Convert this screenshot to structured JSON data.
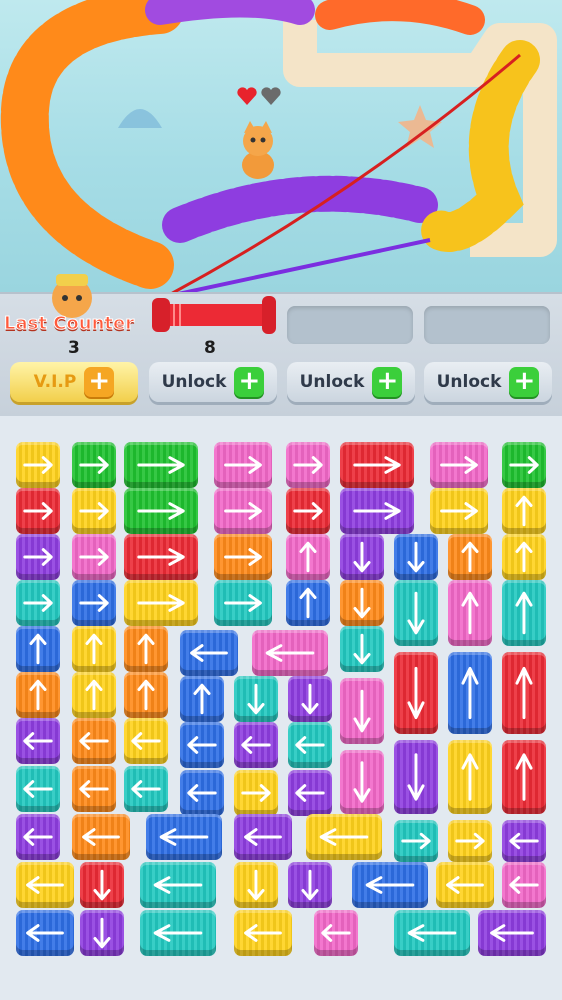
{
  "hud": {
    "last_counter_label": "Last Counter",
    "last_counter_value": "3",
    "spool_count": "8",
    "vip_label": "V.I.P",
    "unlock_label": "Unlock"
  },
  "hearts": [
    "full",
    "empty"
  ],
  "colors": {
    "green": "#1fc230",
    "yellow": "#ffd21c",
    "pink": "#f268c8",
    "red": "#ec2a35",
    "purple": "#8e3de0",
    "blue": "#2e6ee6",
    "teal": "#22c9c0",
    "orange": "#ff8a1a"
  },
  "tiles": [
    {
      "c": "yellow",
      "d": "right"
    },
    {
      "c": "green",
      "d": "right"
    },
    {
      "c": "green",
      "d": "right"
    },
    {
      "c": "pink",
      "d": "right"
    },
    {
      "c": "pink",
      "d": "right"
    },
    {
      "c": "red",
      "d": "right"
    },
    {
      "c": "pink",
      "d": "right"
    },
    {
      "c": "green",
      "d": "right"
    },
    {
      "c": "red",
      "d": "right"
    },
    {
      "c": "yellow",
      "d": "right"
    },
    {
      "c": "green",
      "d": "right"
    },
    {
      "c": "pink",
      "d": "right"
    },
    {
      "c": "red",
      "d": "right"
    },
    {
      "c": "purple",
      "d": "right"
    },
    {
      "c": "yellow",
      "d": "right"
    },
    {
      "c": "yellow",
      "d": "up"
    },
    {
      "c": "purple",
      "d": "right"
    },
    {
      "c": "pink",
      "d": "right"
    },
    {
      "c": "red",
      "d": "right"
    },
    {
      "c": "orange",
      "d": "right"
    },
    {
      "c": "pink",
      "d": "up"
    },
    {
      "c": "purple",
      "d": "down"
    },
    {
      "c": "blue",
      "d": "down"
    },
    {
      "c": "orange",
      "d": "up"
    },
    {
      "c": "yellow",
      "d": "up"
    },
    {
      "c": "teal",
      "d": "right"
    },
    {
      "c": "blue",
      "d": "right"
    },
    {
      "c": "yellow",
      "d": "right"
    },
    {
      "c": "teal",
      "d": "right"
    },
    {
      "c": "blue",
      "d": "up"
    },
    {
      "c": "orange",
      "d": "down"
    },
    {
      "c": "teal",
      "d": "down"
    },
    {
      "c": "pink",
      "d": "up"
    },
    {
      "c": "teal",
      "d": "up"
    },
    {
      "c": "blue",
      "d": "up"
    },
    {
      "c": "yellow",
      "d": "up"
    },
    {
      "c": "orange",
      "d": "up"
    },
    {
      "c": "blue",
      "d": "left"
    },
    {
      "c": "pink",
      "d": "left"
    },
    {
      "c": "teal",
      "d": "down"
    },
    {
      "c": "red",
      "d": "down"
    },
    {
      "c": "blue",
      "d": "up"
    },
    {
      "c": "red",
      "d": "up"
    },
    {
      "c": "orange",
      "d": "up"
    },
    {
      "c": "yellow",
      "d": "up"
    },
    {
      "c": "orange",
      "d": "up"
    },
    {
      "c": "blue",
      "d": "up"
    },
    {
      "c": "teal",
      "d": "down"
    },
    {
      "c": "purple",
      "d": "down"
    },
    {
      "c": "pink",
      "d": "down"
    },
    {
      "c": "purple",
      "d": "left"
    },
    {
      "c": "orange",
      "d": "left"
    },
    {
      "c": "yellow",
      "d": "left"
    },
    {
      "c": "blue",
      "d": "left"
    },
    {
      "c": "purple",
      "d": "left"
    },
    {
      "c": "teal",
      "d": "left"
    },
    {
      "c": "pink",
      "d": "down"
    },
    {
      "c": "purple",
      "d": "down"
    },
    {
      "c": "yellow",
      "d": "up"
    },
    {
      "c": "red",
      "d": "up"
    },
    {
      "c": "teal",
      "d": "left"
    },
    {
      "c": "orange",
      "d": "left"
    },
    {
      "c": "teal",
      "d": "left"
    },
    {
      "c": "blue",
      "d": "left"
    },
    {
      "c": "yellow",
      "d": "right"
    },
    {
      "c": "purple",
      "d": "left"
    },
    {
      "c": "purple",
      "d": "left"
    },
    {
      "c": "orange",
      "d": "left"
    },
    {
      "c": "blue",
      "d": "left"
    },
    {
      "c": "purple",
      "d": "left"
    },
    {
      "c": "yellow",
      "d": "left"
    },
    {
      "c": "teal",
      "d": "right"
    },
    {
      "c": "yellow",
      "d": "right"
    },
    {
      "c": "purple",
      "d": "left"
    },
    {
      "c": "yellow",
      "d": "left"
    },
    {
      "c": "red",
      "d": "down"
    },
    {
      "c": "teal",
      "d": "left"
    },
    {
      "c": "yellow",
      "d": "down"
    },
    {
      "c": "purple",
      "d": "down"
    },
    {
      "c": "blue",
      "d": "left"
    },
    {
      "c": "yellow",
      "d": "left"
    },
    {
      "c": "pink",
      "d": "left"
    },
    {
      "c": "blue",
      "d": "left"
    },
    {
      "c": "purple",
      "d": "down"
    },
    {
      "c": "teal",
      "d": "left"
    },
    {
      "c": "yellow",
      "d": "left"
    },
    {
      "c": "pink",
      "d": "left"
    },
    {
      "c": "teal",
      "d": "left"
    },
    {
      "c": "purple",
      "d": "left"
    }
  ]
}
